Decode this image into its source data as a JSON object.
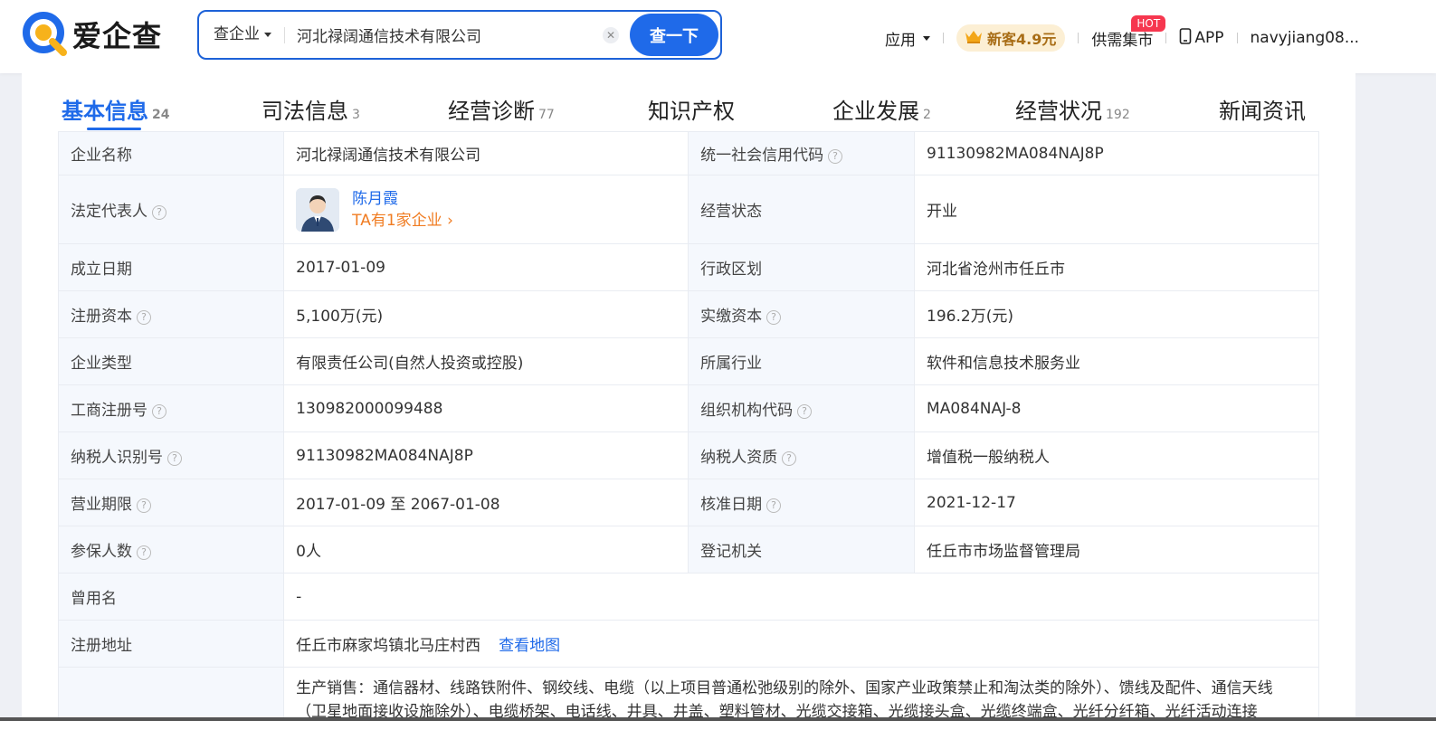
{
  "header": {
    "logo_text": "爱企查",
    "search": {
      "type_label": "查企业",
      "value": "河北禄阔通信技术有限公司",
      "button_label": "查一下"
    },
    "nav": {
      "apps_label": "应用",
      "vip_label": "新客4.9元",
      "market_label": "供需集市",
      "hot_badge": "HOT",
      "app_label": "APP",
      "user_name": "navyjiang08..."
    }
  },
  "tabs": [
    {
      "label": "基本信息",
      "count": "24"
    },
    {
      "label": "司法信息",
      "count": "3"
    },
    {
      "label": "经营诊断",
      "count": "77"
    },
    {
      "label": "知识产权",
      "count": ""
    },
    {
      "label": "企业发展",
      "count": "2"
    },
    {
      "label": "经营状况",
      "count": "192"
    },
    {
      "label": "新闻资讯",
      "count": ""
    }
  ],
  "info": {
    "company_name_label": "企业名称",
    "company_name": "河北禄阔通信技术有限公司",
    "credit_code_label": "统一社会信用代码",
    "credit_code": "91130982MA084NAJ8P",
    "legal_rep_label": "法定代表人",
    "legal_rep_name": "陈月霞",
    "legal_rep_link": "TA有1家企业",
    "status_label": "经营状态",
    "status": "开业",
    "founded_label": "成立日期",
    "founded": "2017-01-09",
    "region_label": "行政区划",
    "region": "河北省沧州市任丘市",
    "reg_capital_label": "注册资本",
    "reg_capital": "5,100万(元)",
    "paid_capital_label": "实缴资本",
    "paid_capital": "196.2万(元)",
    "type_label": "企业类型",
    "type": "有限责任公司(自然人投资或控股)",
    "industry_label": "所属行业",
    "industry": "软件和信息技术服务业",
    "reg_no_label": "工商注册号",
    "reg_no": "130982000099488",
    "org_code_label": "组织机构代码",
    "org_code": "MA084NAJ-8",
    "taxpayer_id_label": "纳税人识别号",
    "taxpayer_id": "91130982MA084NAJ8P",
    "taxpayer_qual_label": "纳税人资质",
    "taxpayer_qual": "增值税一般纳税人",
    "term_label": "营业期限",
    "term": "2017-01-09 至 2067-01-08",
    "approved_label": "核准日期",
    "approved": "2021-12-17",
    "insured_label": "参保人数",
    "insured": "0人",
    "authority_label": "登记机关",
    "authority": "任丘市市场监督管理局",
    "former_name_label": "曾用名",
    "former_name": "-",
    "address_label": "注册地址",
    "address": "任丘市麻家坞镇北马庄村西",
    "map_link": "查看地图",
    "scope_line1": "生产销售：通信器材、线路铁附件、钢绞线、电缆（以上项目普通松弛级别的除外、国家产业政策禁止和淘汰类的除外）、馈线及配件、通信天线",
    "scope_line2": "（卫星地面接收设施除外）、电缆桥架、电话线、井具、井盖、塑料管材、光缆交接箱、光缆接头盒、光缆终端盒、光纤分纤箱、光纤活动连接"
  },
  "colors": {
    "brand_blue": "#1f6ae9",
    "link_orange": "#f07c22",
    "hot_red": "#f6374f"
  }
}
